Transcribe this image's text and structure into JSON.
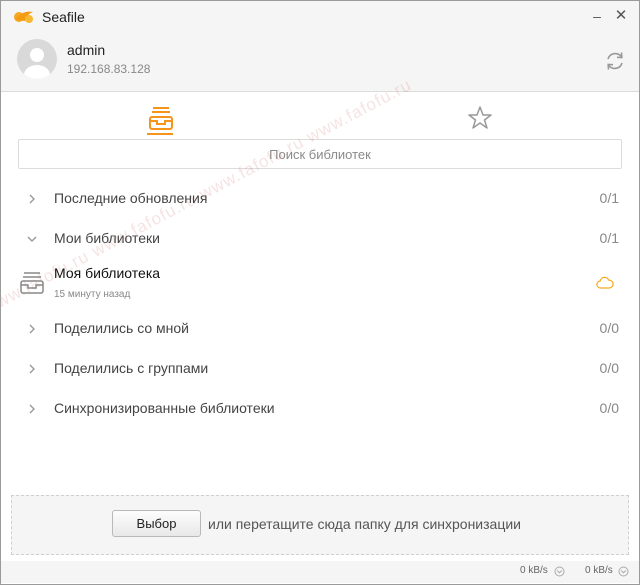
{
  "window": {
    "title": "Seafile",
    "minimize_glyph": "–",
    "close_glyph": "✕"
  },
  "account": {
    "name": "admin",
    "server": "192.168.83.128",
    "avatar_icon": "default-avatar-icon",
    "refresh_icon": "refresh-icon"
  },
  "tabs": [
    {
      "name": "libraries",
      "icon": "library-tray-icon",
      "active": true
    },
    {
      "name": "starred",
      "icon": "star-icon",
      "active": false
    }
  ],
  "search": {
    "placeholder": "Поиск библиотек"
  },
  "categories": [
    {
      "label": "Последние обновления",
      "count": "0/1",
      "expanded": false
    },
    {
      "label": "Мои библиотеки",
      "count": "0/1",
      "expanded": true
    },
    {
      "label": "Поделились со мной",
      "count": "0/0",
      "expanded": false
    },
    {
      "label": "Поделились с группами",
      "count": "0/0",
      "expanded": false
    },
    {
      "label": "Синхронизированные библиотеки",
      "count": "0/0",
      "expanded": false
    }
  ],
  "library": {
    "name": "Моя библиотека",
    "time": "15 минуту назад",
    "status_icon": "cloud-icon"
  },
  "dropzone": {
    "button_label": "Выбор",
    "text": "или перетащите сюда папку для синхронизации"
  },
  "status": {
    "upload_rate": "0 kB/s",
    "download_rate": "0 kB/s"
  },
  "watermark": "www.fafofu.ru www.fafofu.ru www.fafofu.ru www.fafofu.ru",
  "colors": {
    "accent": "#f7941d",
    "header_bg": "#f5f5f5"
  }
}
